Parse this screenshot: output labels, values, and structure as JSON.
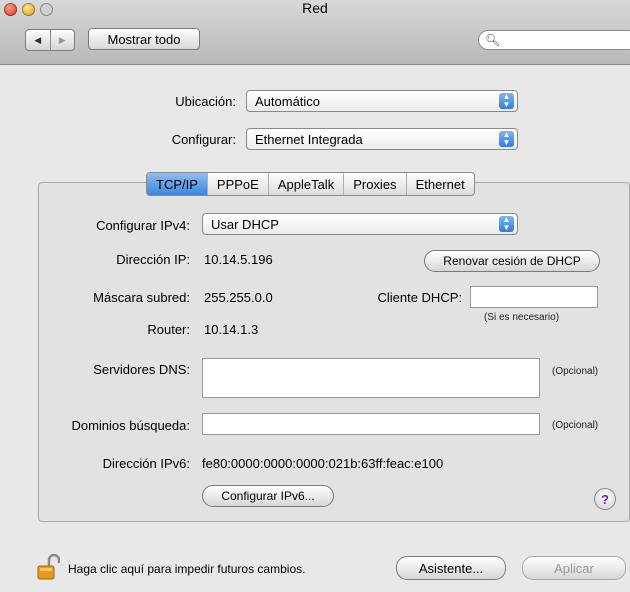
{
  "window": {
    "title": "Red",
    "show_all": "Mostrar todo",
    "search_placeholder": ""
  },
  "location": {
    "label": "Ubicación:",
    "value": "Automático"
  },
  "configure": {
    "label": "Configurar:",
    "value": "Ethernet Integrada"
  },
  "tabs": [
    "TCP/IP",
    "PPPoE",
    "AppleTalk",
    "Proxies",
    "Ethernet"
  ],
  "tcpip": {
    "ipv4_label": "Configurar IPv4:",
    "ipv4_value": "Usar DHCP",
    "ip_label": "Dirección IP:",
    "ip_value": "10.14.5.196",
    "renew_button": "Renovar cesión de DHCP",
    "mask_label": "Máscara subred:",
    "mask_value": "255.255.0.0",
    "dhcp_client_label": "Cliente DHCP:",
    "dhcp_client_value": "",
    "dhcp_client_note": "(Si es necesario)",
    "router_label": "Router:",
    "router_value": "10.14.1.3",
    "dns_label": "Servidores DNS:",
    "dns_value": "",
    "dns_optional": "(Opcional)",
    "domains_label": "Dominios búsqueda:",
    "domains_value": "",
    "domains_optional": "(Opcional)",
    "ipv6_label": "Dirección IPv6:",
    "ipv6_value": "fe80:0000:0000:0000:021b:63ff:feac:e100",
    "configure_ipv6_button": "Configurar IPv6...",
    "help_symbol": "?"
  },
  "footer": {
    "lock_text": "Haga clic aquí para impedir futuros cambios.",
    "assistant_button": "Asistente...",
    "apply_button": "Aplicar"
  }
}
